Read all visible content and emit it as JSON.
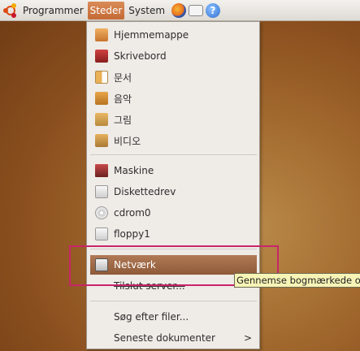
{
  "panel": {
    "menus": [
      {
        "label": "Programmer"
      },
      {
        "label": "Steder"
      },
      {
        "label": "System"
      }
    ]
  },
  "places_menu": {
    "items": [
      {
        "label": "Hjemmemappe",
        "icon": "home-folder-icon"
      },
      {
        "label": "Skrivebord",
        "icon": "desktop-icon"
      },
      {
        "label": "문서",
        "icon": "documents-folder-icon"
      },
      {
        "label": "음악",
        "icon": "music-folder-icon"
      },
      {
        "label": "그림",
        "icon": "pictures-folder-icon"
      },
      {
        "label": "비디오",
        "icon": "videos-folder-icon"
      },
      {
        "label": "Maskine",
        "icon": "computer-icon"
      },
      {
        "label": "Diskettedrev",
        "icon": "floppy-drive-icon"
      },
      {
        "label": "cdrom0",
        "icon": "cdrom-icon"
      },
      {
        "label": "floppy1",
        "icon": "floppy-drive-icon"
      },
      {
        "label": "Netværk",
        "icon": "network-icon"
      },
      {
        "label": "Tilslut server...",
        "icon": ""
      },
      {
        "label": "Søg efter filer...",
        "icon": ""
      },
      {
        "label": "Seneste dokumenter",
        "icon": "",
        "submenu_arrow": ">"
      }
    ]
  },
  "tooltip": {
    "text": "Gennemse bogmærkede og lokale netværksplaceringer"
  }
}
